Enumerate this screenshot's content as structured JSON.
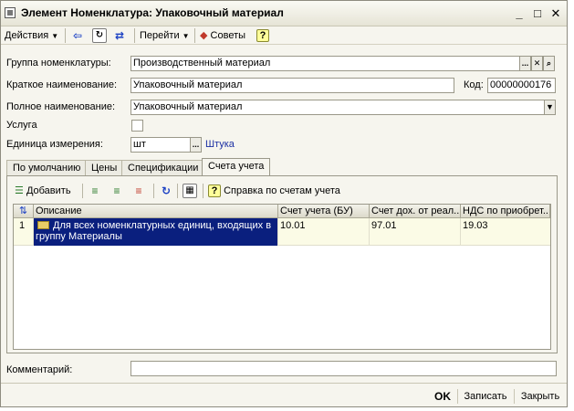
{
  "window": {
    "title": "Элемент Номенклатура: Упаковочный материал",
    "minimize": "_",
    "maximize": "□",
    "close": "✕"
  },
  "toolbar": {
    "actions_label": "Действия",
    "goto_label": "Перейти",
    "tips_label": "Советы",
    "help_label": "?"
  },
  "form": {
    "group_label": "Группа номенклатуры:",
    "group_value": "Производственный материал",
    "short_name_label": "Краткое наименование:",
    "short_name_value": "Упаковочный материал",
    "code_label": "Код:",
    "code_value": "00000000176",
    "full_name_label": "Полное наименование:",
    "full_name_value": "Упаковочный материал",
    "service_label": "Услуга",
    "unit_label": "Единица измерения:",
    "unit_value": "шт",
    "unit_link": "Штука",
    "comment_label": "Комментарий:",
    "comment_value": ""
  },
  "tabs": [
    "По умолчанию",
    "Цены",
    "Спецификации",
    "Счета учета"
  ],
  "panel": {
    "add_label": "Добавить",
    "help_label": "Справка по счетам учета"
  },
  "table": {
    "columns": [
      "Описание",
      "Счет учета (БУ)",
      "Счет дох. от реал...",
      "НДС по приобрет..."
    ],
    "rows": [
      {
        "num": "1",
        "description": "Для всех номенклатурных единиц, входящих в группу Материалы",
        "account": "10.01",
        "income": "97.01",
        "vat": "19.03"
      }
    ]
  },
  "buttons": {
    "ok": "OK",
    "save": "Записать",
    "close": "Закрыть"
  },
  "colors": {
    "selection": "#0a1f7e",
    "link": "#1b2fa3",
    "background": "#f6f5ee"
  }
}
